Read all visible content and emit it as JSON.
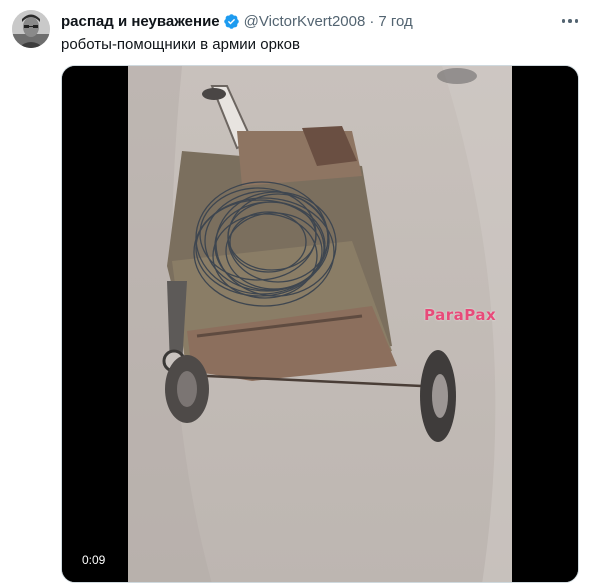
{
  "tweet": {
    "display_name": "распад и неуважение",
    "handle": "@VictorKvert2008",
    "separator": "·",
    "time": "7 год",
    "text": "роботы-помощники в армии орков"
  },
  "media": {
    "watermark": "ParaPax",
    "duration": "0:09"
  },
  "icons": {
    "verified": "verified-badge-icon",
    "more": "more-options-icon"
  },
  "colors": {
    "verified": "#1d9bf0",
    "secondary_text": "#536471",
    "watermark": "#e84a7a"
  }
}
